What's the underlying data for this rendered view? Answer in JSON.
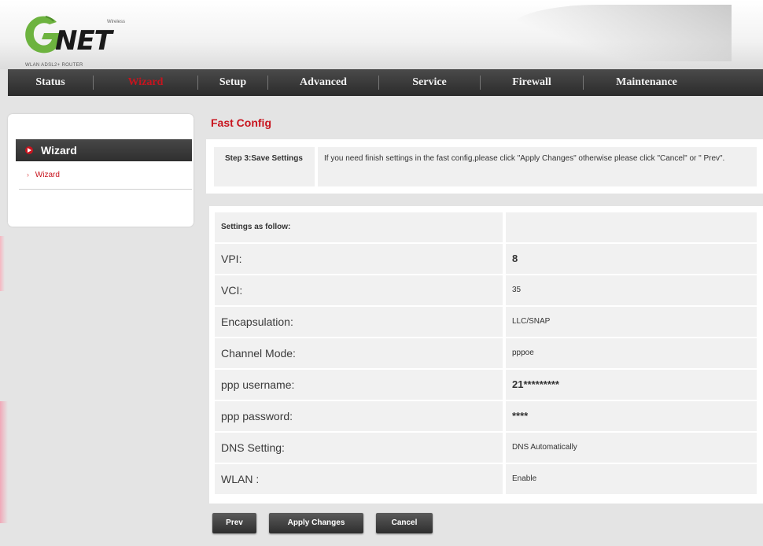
{
  "header": {
    "logo_text": "NET",
    "logo_small": "Wireless",
    "logo_subtitle": "WLAN ADSL2+ ROUTER"
  },
  "nav": {
    "items": [
      {
        "label": "Status"
      },
      {
        "label": "Wizard"
      },
      {
        "label": "Setup"
      },
      {
        "label": "Advanced"
      },
      {
        "label": "Service"
      },
      {
        "label": "Firewall"
      },
      {
        "label": "Maintenance"
      }
    ],
    "active_index": 1
  },
  "sidebar": {
    "title": "Wizard",
    "items": [
      {
        "label": "Wizard"
      }
    ]
  },
  "main": {
    "title": "Fast Config",
    "step": {
      "label": "Step 3:Save Settings",
      "text": "If you need finish settings in the fast config,please click \"Apply Changes\" otherwise please click \"Cancel\" or \" Prev\"."
    },
    "settings": {
      "heading": "Settings as follow:",
      "rows": [
        {
          "label": "VPI:",
          "value": "8"
        },
        {
          "label": "VCI:",
          "value": "35"
        },
        {
          "label": "Encapsulation:",
          "value": "LLC/SNAP"
        },
        {
          "label": "Channel Mode:",
          "value": "pppoe"
        },
        {
          "label": "ppp username:",
          "value": "21*********"
        },
        {
          "label": "ppp password:",
          "value": "****"
        },
        {
          "label": "DNS Setting:",
          "value": "DNS Automatically"
        },
        {
          "label": "WLAN :",
          "value": "Enable"
        }
      ]
    }
  },
  "buttons": {
    "prev": "Prev",
    "apply": "Apply Changes",
    "cancel": "Cancel"
  },
  "colors": {
    "accent": "#c8141e",
    "nav_bg": "#2b2b2b",
    "logo_green": "#6db33f"
  }
}
